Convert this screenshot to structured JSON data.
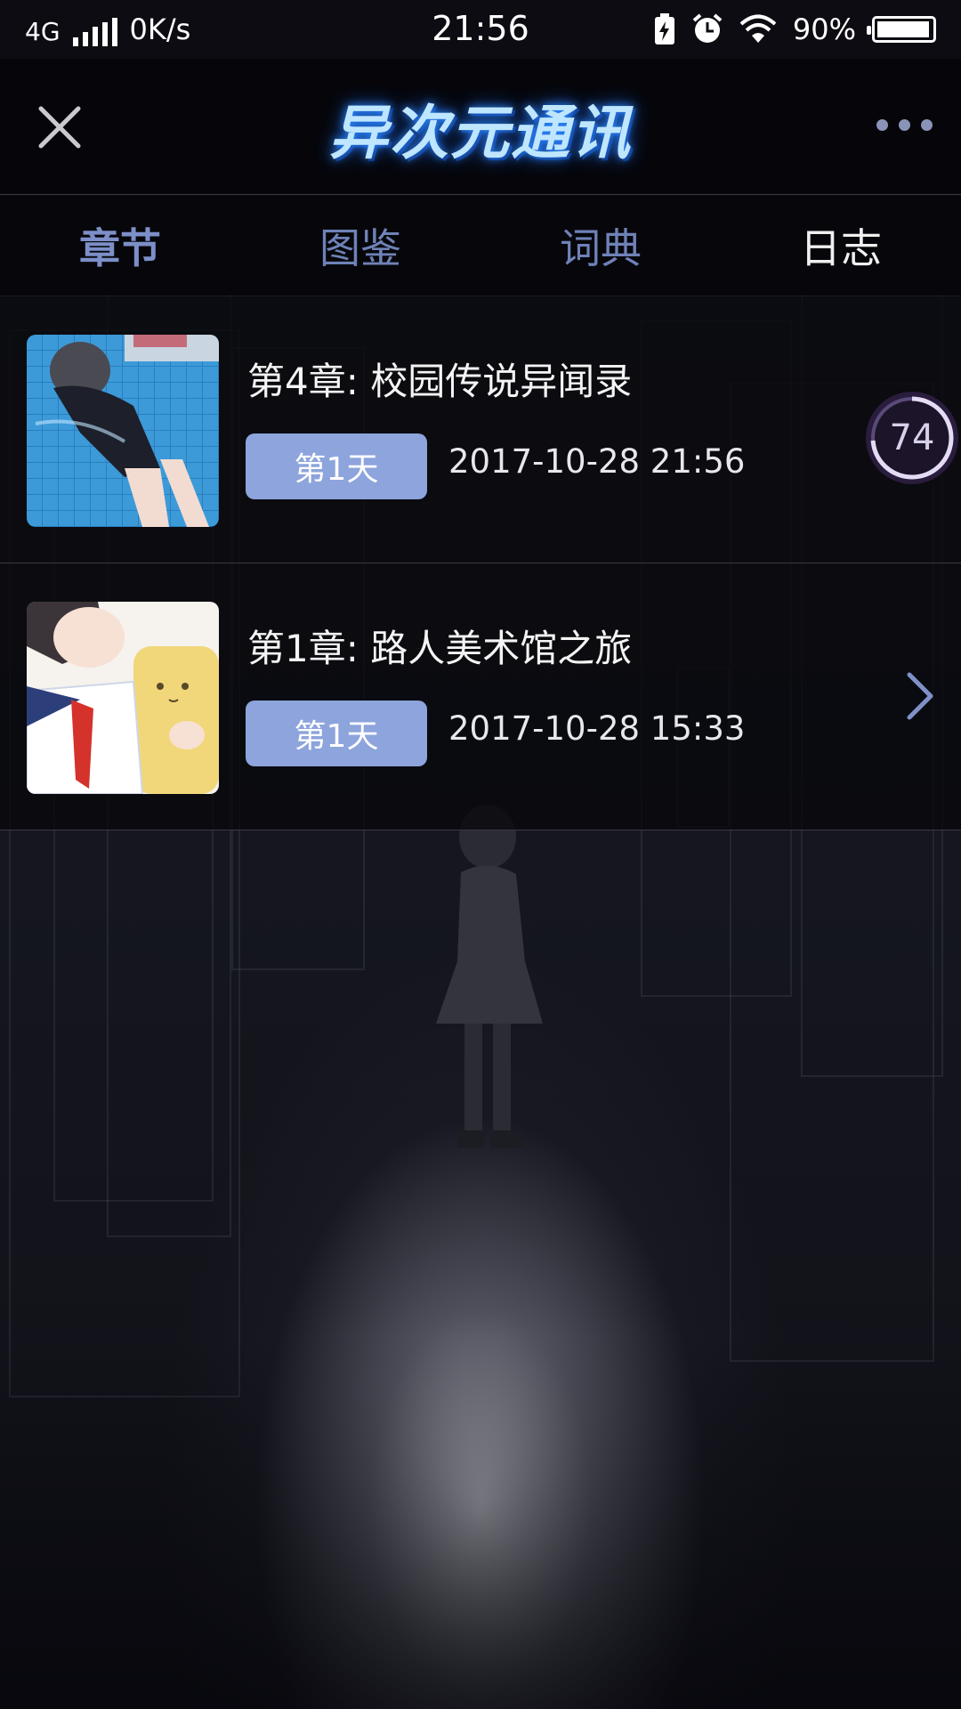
{
  "status_bar": {
    "network": "4G",
    "speed": "0K/s",
    "time": "21:56",
    "battery": "90%",
    "icons": [
      "charging-icon",
      "alarm-icon",
      "wifi-icon",
      "battery-icon"
    ]
  },
  "header": {
    "logo_text": "异次元通讯",
    "close_icon": "close-icon",
    "more_icon": "more-icon"
  },
  "tabs": [
    {
      "label": "章节"
    },
    {
      "label": "图鉴"
    },
    {
      "label": "词典"
    },
    {
      "label": "日志"
    }
  ],
  "chapters": [
    {
      "title": "第4章: 校园传说异闻录",
      "day": "第1天",
      "date": "2017-10-28 21:56",
      "progress": "74"
    },
    {
      "title": "第1章: 路人美术馆之旅",
      "day": "第1天",
      "date": "2017-10-28 15:33"
    }
  ],
  "colors": {
    "accent": "#8da4dc",
    "tab_active": "#7d8fc8",
    "ring": "#b8a6e0"
  }
}
